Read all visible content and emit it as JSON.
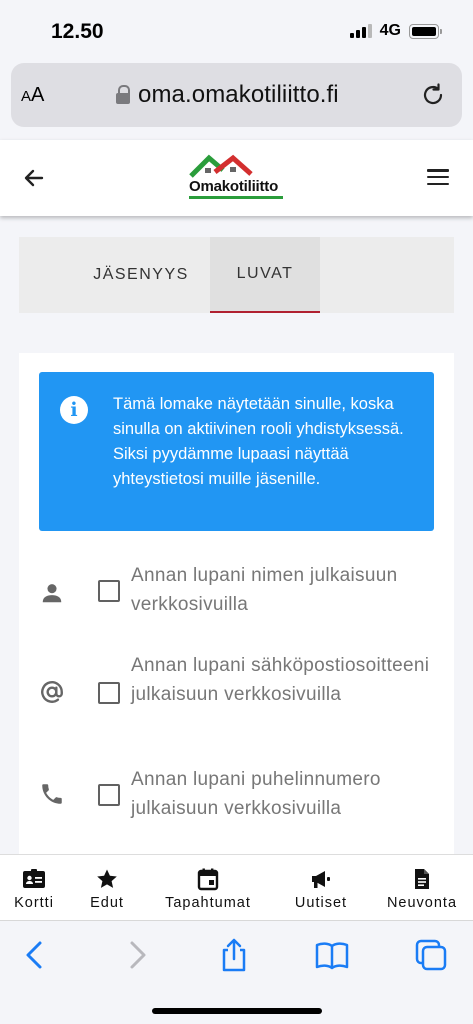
{
  "status_bar": {
    "time": "12.50",
    "network": "4G"
  },
  "browser": {
    "text_size_label_small": "A",
    "text_size_label_large": "A",
    "url": "oma.omakotiliitto.fi"
  },
  "header": {
    "logo_text": "Omakotiliitto"
  },
  "tabs": [
    {
      "label": "JÄSENYYS",
      "active": false
    },
    {
      "label": "LUVAT",
      "active": true
    }
  ],
  "info": {
    "text": "Tämä lomake näytetään sinulle, koska sinulla on aktiivinen rooli yhdistyksessä. Siksi pyydämme lupaasi näyttää yhteystietosi muille jäsenille."
  },
  "permissions": [
    {
      "icon": "person-icon",
      "label": "Annan lupani nimen julkaisuun verkkosivuilla",
      "checked": false
    },
    {
      "icon": "at-sign-icon",
      "label": "Annan lupani sähköpostiosoitteeni julkaisuun verkkosivuilla",
      "checked": false
    },
    {
      "icon": "phone-icon",
      "label": "Annan lupani puhelinnumero julkaisuun verkkosivuilla",
      "checked": false
    }
  ],
  "bottom_nav": [
    {
      "icon": "id-card-icon",
      "label": "Kortti"
    },
    {
      "icon": "star-icon",
      "label": "Edut"
    },
    {
      "icon": "calendar-icon",
      "label": "Tapahtumat"
    },
    {
      "icon": "megaphone-icon",
      "label": "Uutiset"
    },
    {
      "icon": "document-icon",
      "label": "Neuvonta"
    }
  ],
  "colors": {
    "info_blue": "#2196f3",
    "tab_underline": "#b02030",
    "logo_green": "#2a9d3b",
    "logo_red": "#d32f2f",
    "safari_blue": "#1a7cf5"
  }
}
